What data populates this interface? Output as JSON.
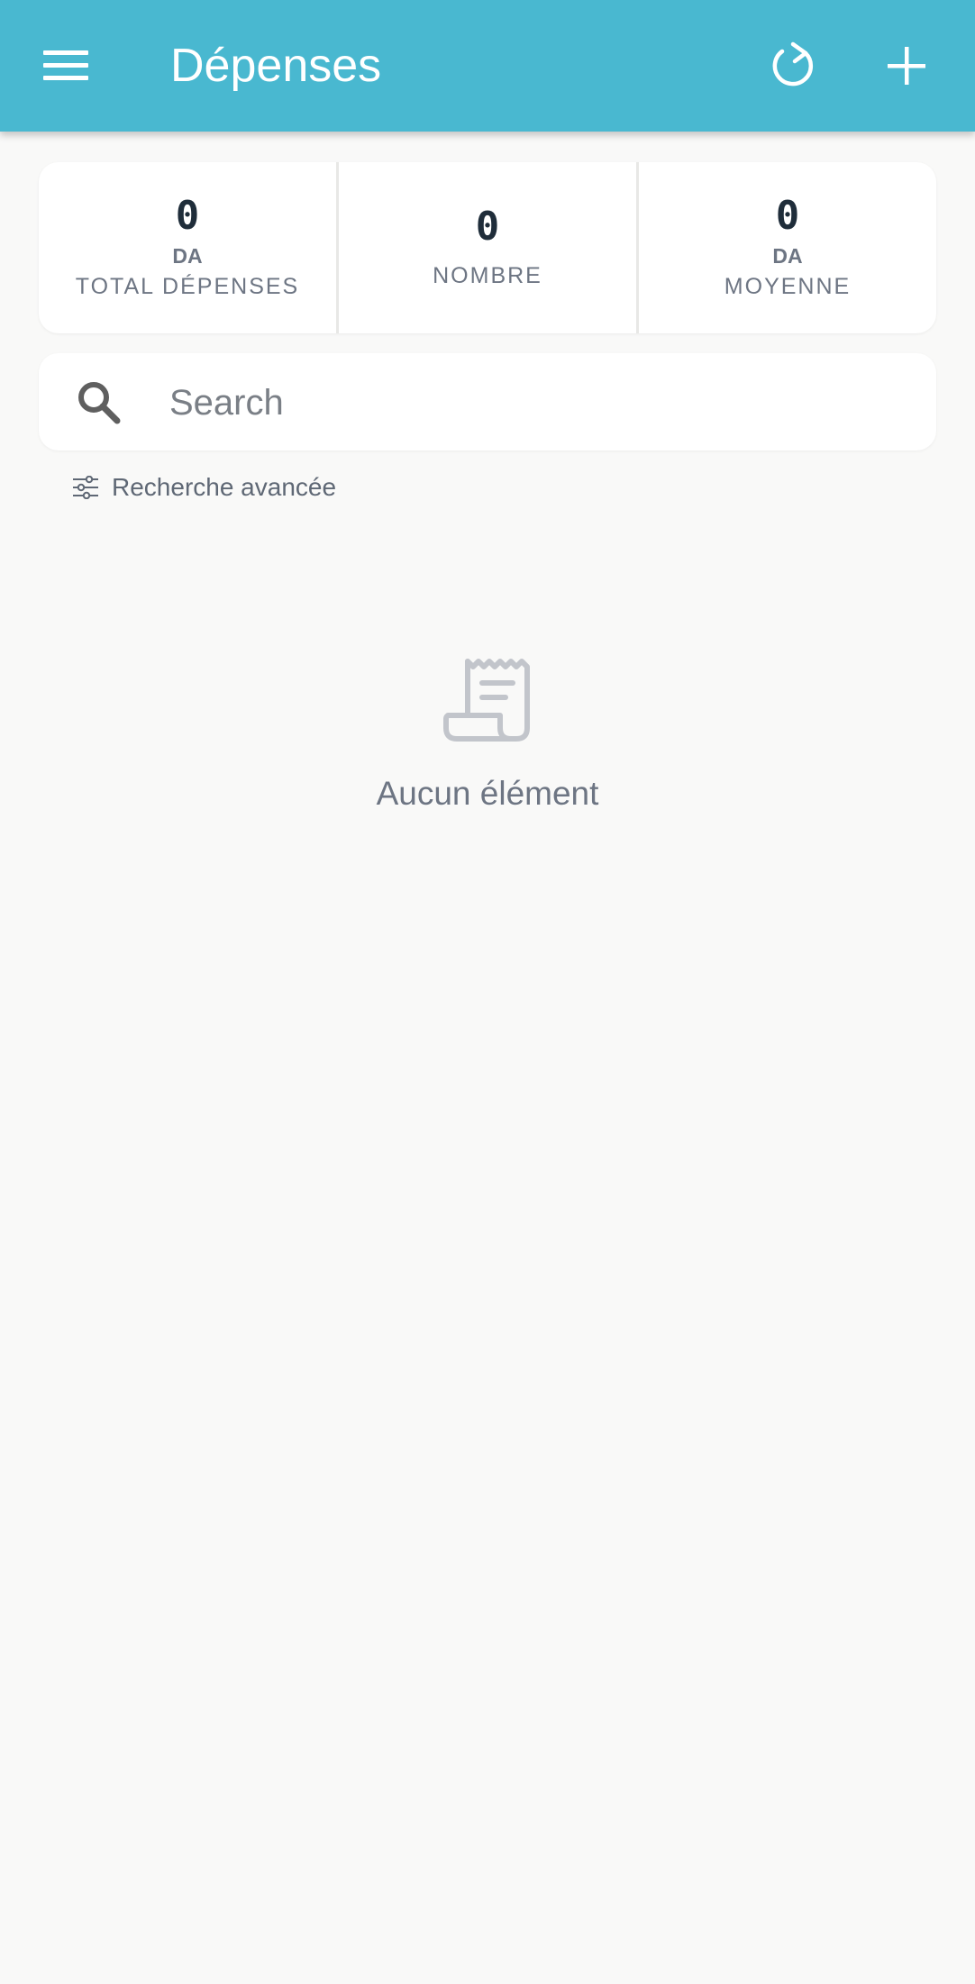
{
  "appbar": {
    "title": "Dépenses",
    "icons": {
      "menu": "menu-icon",
      "refresh": "refresh-icon",
      "add": "add-icon"
    },
    "color": "#49b8d0"
  },
  "stats": [
    {
      "value": "0",
      "unit": "DA",
      "label": "TOTAL DÉPENSES"
    },
    {
      "value": "0",
      "label": "NOMBRE"
    },
    {
      "value": "0",
      "unit": "DA",
      "label": "MOYENNE"
    }
  ],
  "search": {
    "placeholder": "Search",
    "value": ""
  },
  "advanced_search": {
    "label": "Recherche avancée"
  },
  "empty_state": {
    "icon": "receipt-icon",
    "message": "Aucun élément"
  }
}
